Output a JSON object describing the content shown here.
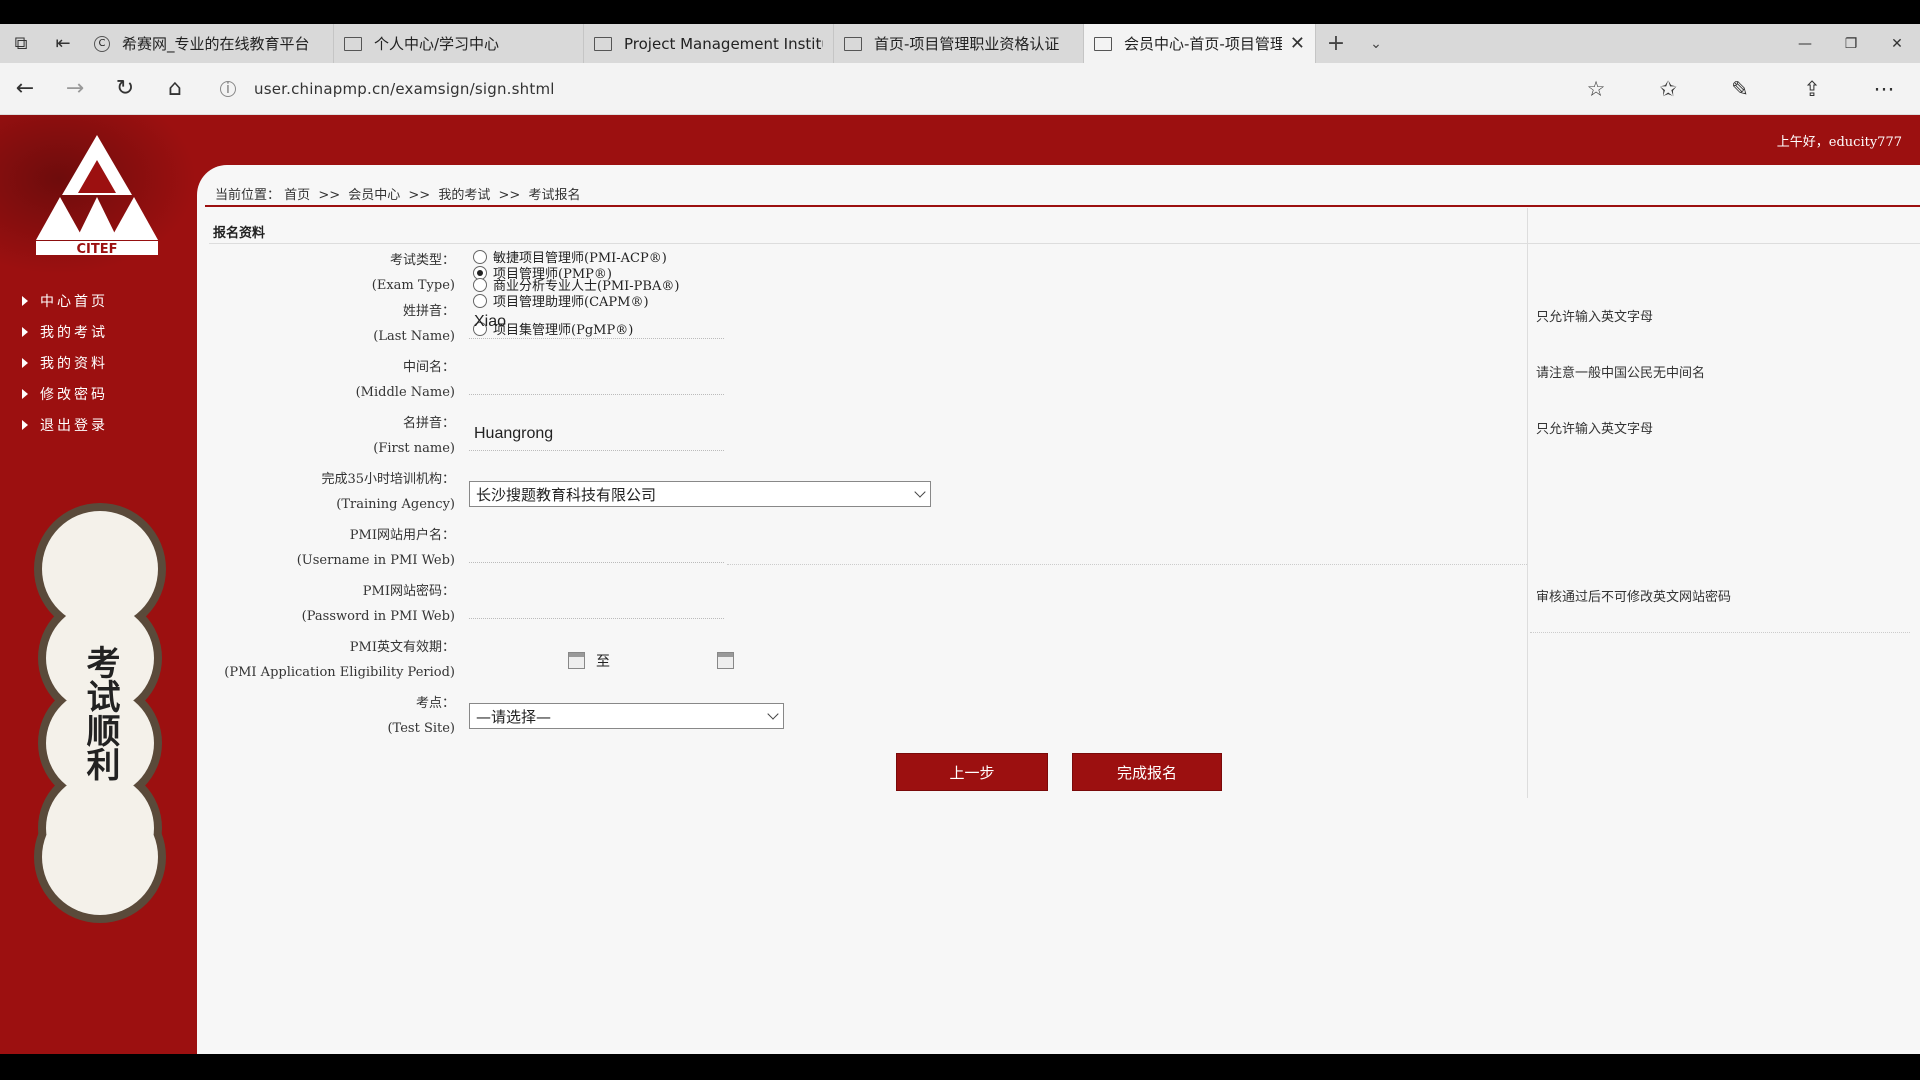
{
  "browser": {
    "tabs": [
      {
        "label": "希赛网_专业的在线教育平台"
      },
      {
        "label": "个人中心/学习中心"
      },
      {
        "label": "Project Management Institu"
      },
      {
        "label": "首页-项目管理职业资格认证"
      },
      {
        "label": "会员中心-首页-项目管理",
        "active": true
      }
    ],
    "url": "user.chinapmp.cn/examsign/sign.shtml"
  },
  "header": {
    "greeting": "上午好，educity777"
  },
  "sidebar": {
    "logo_text": "CITEF",
    "items": [
      {
        "label": "中心首页"
      },
      {
        "label": "我的考试"
      },
      {
        "label": "我的资料"
      },
      {
        "label": "修改密码"
      },
      {
        "label": "退出登录"
      }
    ],
    "badge_text": "考试顺利"
  },
  "breadcrumb": {
    "prefix": "当前位置：",
    "items": [
      "首页",
      "会员中心",
      "我的考试",
      "考试报名"
    ],
    "separator": ">>"
  },
  "section": {
    "title": "报名资料"
  },
  "form": {
    "exam_type": {
      "label_cn": "考试类型：",
      "label_en": "(Exam Type)",
      "options": [
        {
          "label": "项目管理师(PMP®)",
          "checked": true
        },
        {
          "label": "项目管理助理师(CAPM®)",
          "checked": false
        },
        {
          "label": "项目集管理师(PgMP®)",
          "checked": false
        },
        {
          "label": "敏捷项目管理师(PMI-ACP®)",
          "checked": false
        },
        {
          "label": "商业分析专业人士(PMI-PBA®)",
          "checked": false
        }
      ]
    },
    "last_name": {
      "label_cn": "姓拼音：",
      "label_en": "(Last Name)",
      "value": "Xiao",
      "hint": "只允许输入英文字母"
    },
    "middle_name": {
      "label_cn": "中间名：",
      "label_en": "(Middle Name)",
      "value": "",
      "hint": "请注意一般中国公民无中间名"
    },
    "first_name": {
      "label_cn": "名拼音：",
      "label_en": "(First name)",
      "value": "Huangrong",
      "hint": "只允许输入英文字母"
    },
    "training_agency": {
      "label_cn": "完成35小时培训机构：",
      "label_en": "(Training Agency)",
      "value": "长沙搜题教育科技有限公司"
    },
    "pmi_username": {
      "label_cn": "PMI网站用户名：",
      "label_en": "(Username in PMI Web)",
      "value": ""
    },
    "pmi_password": {
      "label_cn": "PMI网站密码：",
      "label_en": "(Password in PMI Web)",
      "value": "",
      "hint": "审核通过后不可修改英文网站密码"
    },
    "eligibility": {
      "label_cn": "PMI英文有效期：",
      "label_en": "(PMI Application Eligibility Period)",
      "to": "至"
    },
    "test_site": {
      "label_cn": "考点：",
      "label_en": "(Test Site)",
      "value": "—请选择—"
    }
  },
  "buttons": {
    "prev": "上一步",
    "submit": "完成报名"
  },
  "colors": {
    "brand_red": "#9c1010"
  }
}
